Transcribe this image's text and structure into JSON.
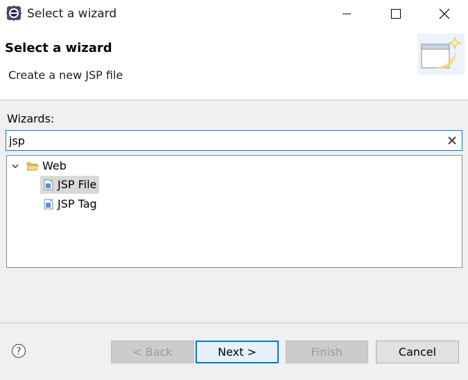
{
  "window": {
    "title": "Select a wizard"
  },
  "banner": {
    "title": "Select a wizard",
    "description": "Create a new JSP file"
  },
  "wizards": {
    "label": "Wizards:",
    "filter_value": "jsp",
    "tree": [
      {
        "label": "Web",
        "expanded": true,
        "icon": "folder-open-icon"
      },
      {
        "label": "JSP File",
        "selected": true,
        "icon": "jsp-file-icon"
      },
      {
        "label": "JSP Tag",
        "selected": false,
        "icon": "jsp-file-icon"
      }
    ]
  },
  "buttons": {
    "back": "< Back",
    "next": "Next >",
    "finish": "Finish",
    "cancel": "Cancel"
  },
  "colors": {
    "accent": "#0078d7",
    "selection": "#d9d9d9",
    "dialog_bg": "#f0f0f0"
  }
}
